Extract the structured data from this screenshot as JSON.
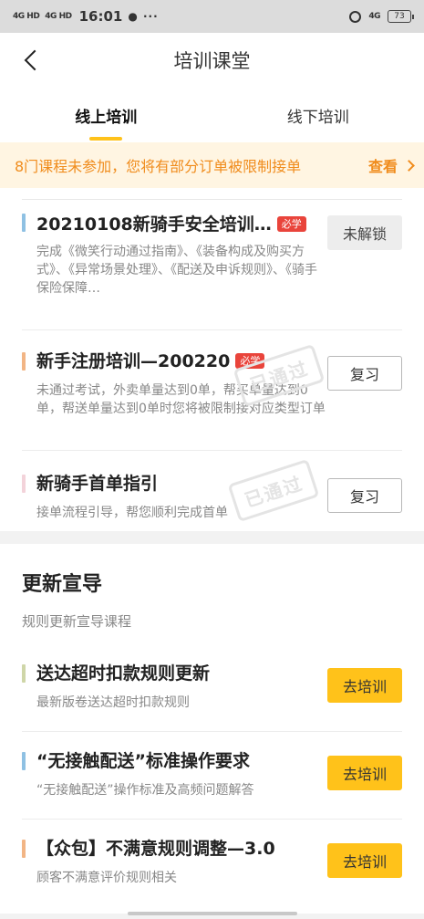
{
  "status": {
    "signal1": "4G HD",
    "signal2": "4G HD",
    "time": "16:01",
    "more": "● ···",
    "network": "4G",
    "battery": "73"
  },
  "nav": {
    "title": "培训课堂"
  },
  "tabs": [
    {
      "label": "线上培训",
      "active": true
    },
    {
      "label": "线下培训",
      "active": false
    }
  ],
  "notice": {
    "message": "8门课程未参加，您将有部分订单被限制接单",
    "link": "查看"
  },
  "online_courses": [
    {
      "title": "20210108新骑手安全培训…",
      "badge": "必学",
      "desc": "完成《微笑行动通过指南》、《装备构成及购买方式》、《异常场景处理》、《配送及申诉规则》、《骑手保险保障…",
      "button": "未解锁",
      "bar_color": "#8fc1e3"
    },
    {
      "title": "新手注册培训—200220",
      "badge": "必学",
      "desc": "未通过考试，外卖单量达到0单，帮买单量达到0单，帮送单量达到0单时您将被限制接对应类型订单",
      "button": "复习",
      "stamp": "已通过",
      "bar_color": "#f2b585"
    },
    {
      "title": "新骑手首单指引",
      "desc": "接单流程引导，帮您顺利完成首单",
      "button": "复习",
      "stamp": "已通过",
      "bar_color": "#f3d3da"
    }
  ],
  "update_section": {
    "title": "更新宣导",
    "subtitle": "规则更新宣导课程",
    "courses": [
      {
        "title": "送达超时扣款规则更新",
        "desc": "最新版卷送达超时扣款规则",
        "button": "去培训",
        "bar_color": "#cfd6a8"
      },
      {
        "title": "“无接触配送”标准操作要求",
        "desc": "“无接触配送”操作标准及高频问题解答",
        "button": "去培训",
        "bar_color": "#8fc1e3"
      },
      {
        "title": "【众包】不满意规则调整—3.0",
        "desc": "顾客不满意评价规则相关",
        "button": "去培训",
        "bar_color": "#f2b585"
      }
    ]
  }
}
